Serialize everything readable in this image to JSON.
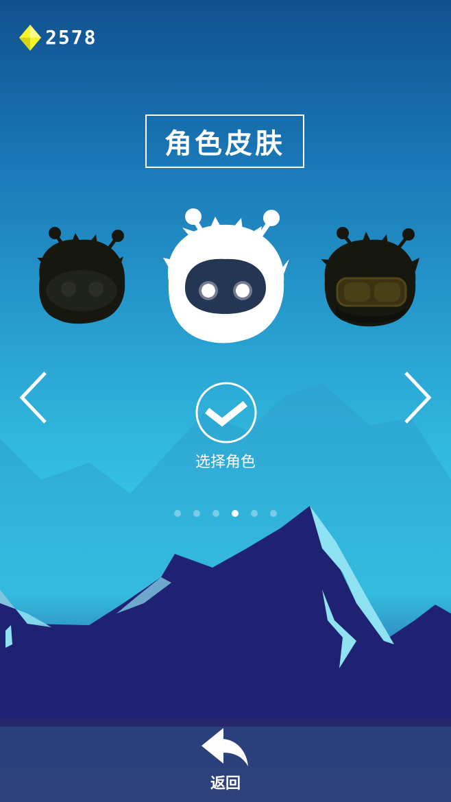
{
  "currency": {
    "icon": "gem-icon",
    "count": "2578",
    "color": "#f4f52a"
  },
  "title": "角色皮肤",
  "characters": [
    {
      "name": "yeti-orange-character",
      "state": "locked"
    },
    {
      "name": "yeti-white-character",
      "state": "selected"
    },
    {
      "name": "yeti-goggles-character",
      "state": "locked"
    }
  ],
  "navigation": {
    "prev_icon": "chevron-left-icon",
    "next_icon": "chevron-right-icon"
  },
  "select": {
    "icon": "checkmark-icon",
    "label": "选择角色"
  },
  "pagination": {
    "count": 6,
    "active_index": 3
  },
  "back": {
    "icon": "back-arrow-icon",
    "label": "返回"
  },
  "colors": {
    "mountain_dark": "#1f2272",
    "mountain_highlight": "#8fe2f1",
    "sky_top": "#11508f"
  }
}
